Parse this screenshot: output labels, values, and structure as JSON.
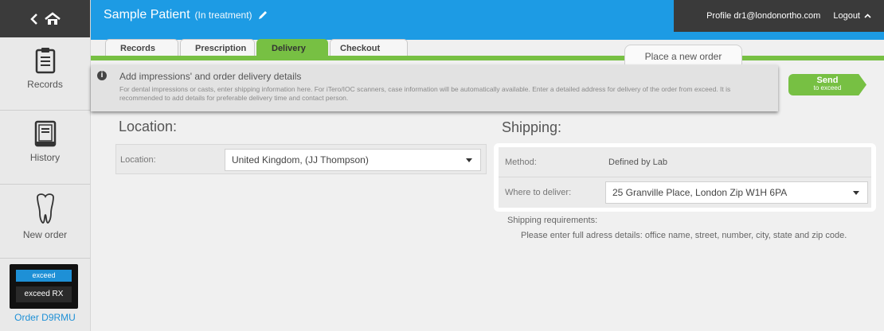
{
  "sidebar": {
    "items": [
      {
        "label": "Records",
        "icon": "clipboard-icon"
      },
      {
        "label": "History",
        "icon": "book-icon"
      },
      {
        "label": "New order",
        "icon": "tooth-icon"
      }
    ],
    "logo_top": "exceed",
    "logo_bottom": "exceed RX",
    "order_id": "Order D9RMU"
  },
  "header": {
    "patient_name": "Sample Patient",
    "status": "(In treatment)",
    "profile": "Profile  dr1@londonortho.com",
    "logout": "Logout"
  },
  "tabs": [
    "Records",
    "Prescription",
    "Delivery",
    "Checkout"
  ],
  "active_tab": "Delivery",
  "place_order": "Place a new order",
  "info": {
    "title": "Add impressions' and order delivery details",
    "text": "For dental impressions or casts, enter shipping information here. For iTero/IOC scanners, case information will be automatically available. Enter a detailed address for delivery of the order from exceed. It is recommended to add details for preferable delivery time and contact person."
  },
  "send": {
    "label": "Send",
    "sub": "to exceed"
  },
  "location": {
    "title": "Location:",
    "field_label": "Location:",
    "value": "United Kingdom, (JJ Thompson)"
  },
  "shipping": {
    "title": "Shipping:",
    "method_label": "Method:",
    "method_value": "Defined by Lab",
    "deliver_label": "Where to deliver:",
    "deliver_value": "25 Granville Place, London Zip W1H 6PA",
    "requirements_label": "Shipping requirements:",
    "requirements_text": "Please enter full adress details: office name, street, number, city, state and zip code."
  },
  "colors": {
    "header_blue": "#1d9be4",
    "accent_green": "#77c043",
    "dark": "#3a3a3a",
    "link_blue": "#1e90d6"
  }
}
